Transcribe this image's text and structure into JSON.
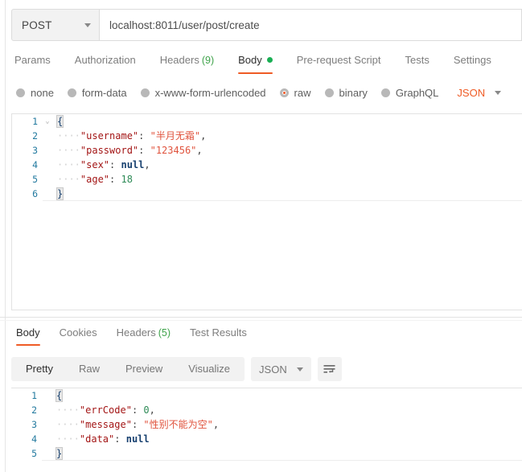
{
  "request_bar": {
    "method": "POST",
    "method_caret": "chevron-down-icon",
    "url": "localhost:8011/user/post/create"
  },
  "request_tabs": [
    {
      "label": "Params",
      "count": null,
      "active": false,
      "dot": false
    },
    {
      "label": "Authorization",
      "count": null,
      "active": false,
      "dot": false
    },
    {
      "label": "Headers",
      "count": "(9)",
      "active": false,
      "dot": false
    },
    {
      "label": "Body",
      "count": null,
      "active": true,
      "dot": true
    },
    {
      "label": "Pre-request Script",
      "count": null,
      "active": false,
      "dot": false
    },
    {
      "label": "Tests",
      "count": null,
      "active": false,
      "dot": false
    },
    {
      "label": "Settings",
      "count": null,
      "active": false,
      "dot": false
    }
  ],
  "body_types": [
    {
      "label": "none",
      "selected": false
    },
    {
      "label": "form-data",
      "selected": false
    },
    {
      "label": "x-www-form-urlencoded",
      "selected": false
    },
    {
      "label": "raw",
      "selected": true
    },
    {
      "label": "binary",
      "selected": false
    },
    {
      "label": "GraphQL",
      "selected": false
    }
  ],
  "body_format": {
    "value": "JSON",
    "caret": "chevron-down-icon"
  },
  "request_body": {
    "lines": [
      {
        "num": "1",
        "fold": "⌄",
        "parts": [
          {
            "t": "{",
            "c": "br brhl"
          }
        ]
      },
      {
        "num": "2",
        "fold": "",
        "parts": [
          {
            "t": "····",
            "c": "dots"
          },
          {
            "t": "\"username\"",
            "c": "k"
          },
          {
            "t": ": ",
            "c": "p"
          },
          {
            "t": "\"半月无霜\"",
            "c": "s"
          },
          {
            "t": ",",
            "c": "p"
          }
        ]
      },
      {
        "num": "3",
        "fold": "",
        "parts": [
          {
            "t": "····",
            "c": "dots"
          },
          {
            "t": "\"password\"",
            "c": "k"
          },
          {
            "t": ": ",
            "c": "p"
          },
          {
            "t": "\"123456\"",
            "c": "s"
          },
          {
            "t": ",",
            "c": "p"
          }
        ]
      },
      {
        "num": "4",
        "fold": "",
        "parts": [
          {
            "t": "····",
            "c": "dots"
          },
          {
            "t": "\"sex\"",
            "c": "k"
          },
          {
            "t": ": ",
            "c": "p"
          },
          {
            "t": "null",
            "c": "nl"
          },
          {
            "t": ",",
            "c": "p"
          }
        ]
      },
      {
        "num": "5",
        "fold": "",
        "parts": [
          {
            "t": "····",
            "c": "dots"
          },
          {
            "t": "\"age\"",
            "c": "k"
          },
          {
            "t": ": ",
            "c": "p"
          },
          {
            "t": "18",
            "c": "n"
          }
        ]
      },
      {
        "num": "6",
        "fold": "",
        "parts": [
          {
            "t": "}",
            "c": "br brhl"
          }
        ]
      }
    ]
  },
  "response_tabs": [
    {
      "label": "Body",
      "count": null,
      "active": true
    },
    {
      "label": "Cookies",
      "count": null,
      "active": false
    },
    {
      "label": "Headers",
      "count": "(5)",
      "active": false
    },
    {
      "label": "Test Results",
      "count": null,
      "active": false
    }
  ],
  "response_toolbar": {
    "views": [
      {
        "label": "Pretty",
        "active": true
      },
      {
        "label": "Raw",
        "active": false
      },
      {
        "label": "Preview",
        "active": false
      },
      {
        "label": "Visualize",
        "active": false
      }
    ],
    "format": {
      "value": "JSON",
      "caret": "chevron-down-icon"
    },
    "wrap_icon": "word-wrap-icon"
  },
  "response_body": {
    "lines": [
      {
        "num": "1",
        "fold": "",
        "parts": [
          {
            "t": "{",
            "c": "br brhl"
          }
        ]
      },
      {
        "num": "2",
        "fold": "",
        "parts": [
          {
            "t": "····",
            "c": "dots"
          },
          {
            "t": "\"errCode\"",
            "c": "k"
          },
          {
            "t": ": ",
            "c": "p"
          },
          {
            "t": "0",
            "c": "n"
          },
          {
            "t": ",",
            "c": "p"
          }
        ]
      },
      {
        "num": "3",
        "fold": "",
        "parts": [
          {
            "t": "····",
            "c": "dots"
          },
          {
            "t": "\"message\"",
            "c": "k"
          },
          {
            "t": ": ",
            "c": "p"
          },
          {
            "t": "\"性别不能为空\"",
            "c": "s"
          },
          {
            "t": ",",
            "c": "p"
          }
        ]
      },
      {
        "num": "4",
        "fold": "",
        "parts": [
          {
            "t": "····",
            "c": "dots"
          },
          {
            "t": "\"data\"",
            "c": "k"
          },
          {
            "t": ": ",
            "c": "p"
          },
          {
            "t": "null",
            "c": "nl"
          }
        ]
      },
      {
        "num": "5",
        "fold": "",
        "parts": [
          {
            "t": "}",
            "c": "br brhl"
          }
        ]
      }
    ]
  },
  "colors": {
    "accent": "#ef5b25",
    "green": "#1aaf54",
    "count_green": "#3fa34b",
    "json_orange": "#ef5b25",
    "gutter_blue": "#237a9f"
  }
}
